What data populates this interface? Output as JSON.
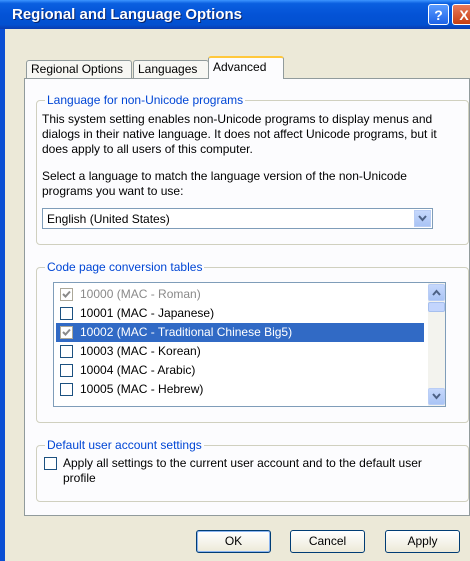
{
  "window": {
    "title": "Regional and Language Options",
    "help_label": "?",
    "close_label": "X"
  },
  "tabs": [
    {
      "label": "Regional Options"
    },
    {
      "label": "Languages"
    },
    {
      "label": "Advanced",
      "active": true
    }
  ],
  "non_unicode": {
    "legend": "Language for non-Unicode programs",
    "description": "This system setting enables non-Unicode programs to display menus and dialogs in their native language. It does not affect Unicode programs, but it does apply to all users of this computer.",
    "instruction": "Select a language to match the language version of the non-Unicode programs you want to use:",
    "selected_language": "English (United States)"
  },
  "code_pages": {
    "legend": "Code page conversion tables",
    "items": [
      {
        "label": "10000 (MAC - Roman)",
        "checked": true,
        "disabled": true,
        "selected": false
      },
      {
        "label": "10001 (MAC - Japanese)",
        "checked": false,
        "disabled": false,
        "selected": false
      },
      {
        "label": "10002 (MAC - Traditional Chinese Big5)",
        "checked": true,
        "disabled": true,
        "selected": true
      },
      {
        "label": "10003 (MAC - Korean)",
        "checked": false,
        "disabled": false,
        "selected": false
      },
      {
        "label": "10004 (MAC - Arabic)",
        "checked": false,
        "disabled": false,
        "selected": false
      },
      {
        "label": "10005 (MAC - Hebrew)",
        "checked": false,
        "disabled": false,
        "selected": false
      }
    ]
  },
  "default_user": {
    "legend": "Default user account settings",
    "checkbox_label": "Apply all settings to the current user account and to the default user profile",
    "checked": false
  },
  "buttons": {
    "ok": "OK",
    "cancel": "Cancel",
    "apply": "Apply"
  }
}
